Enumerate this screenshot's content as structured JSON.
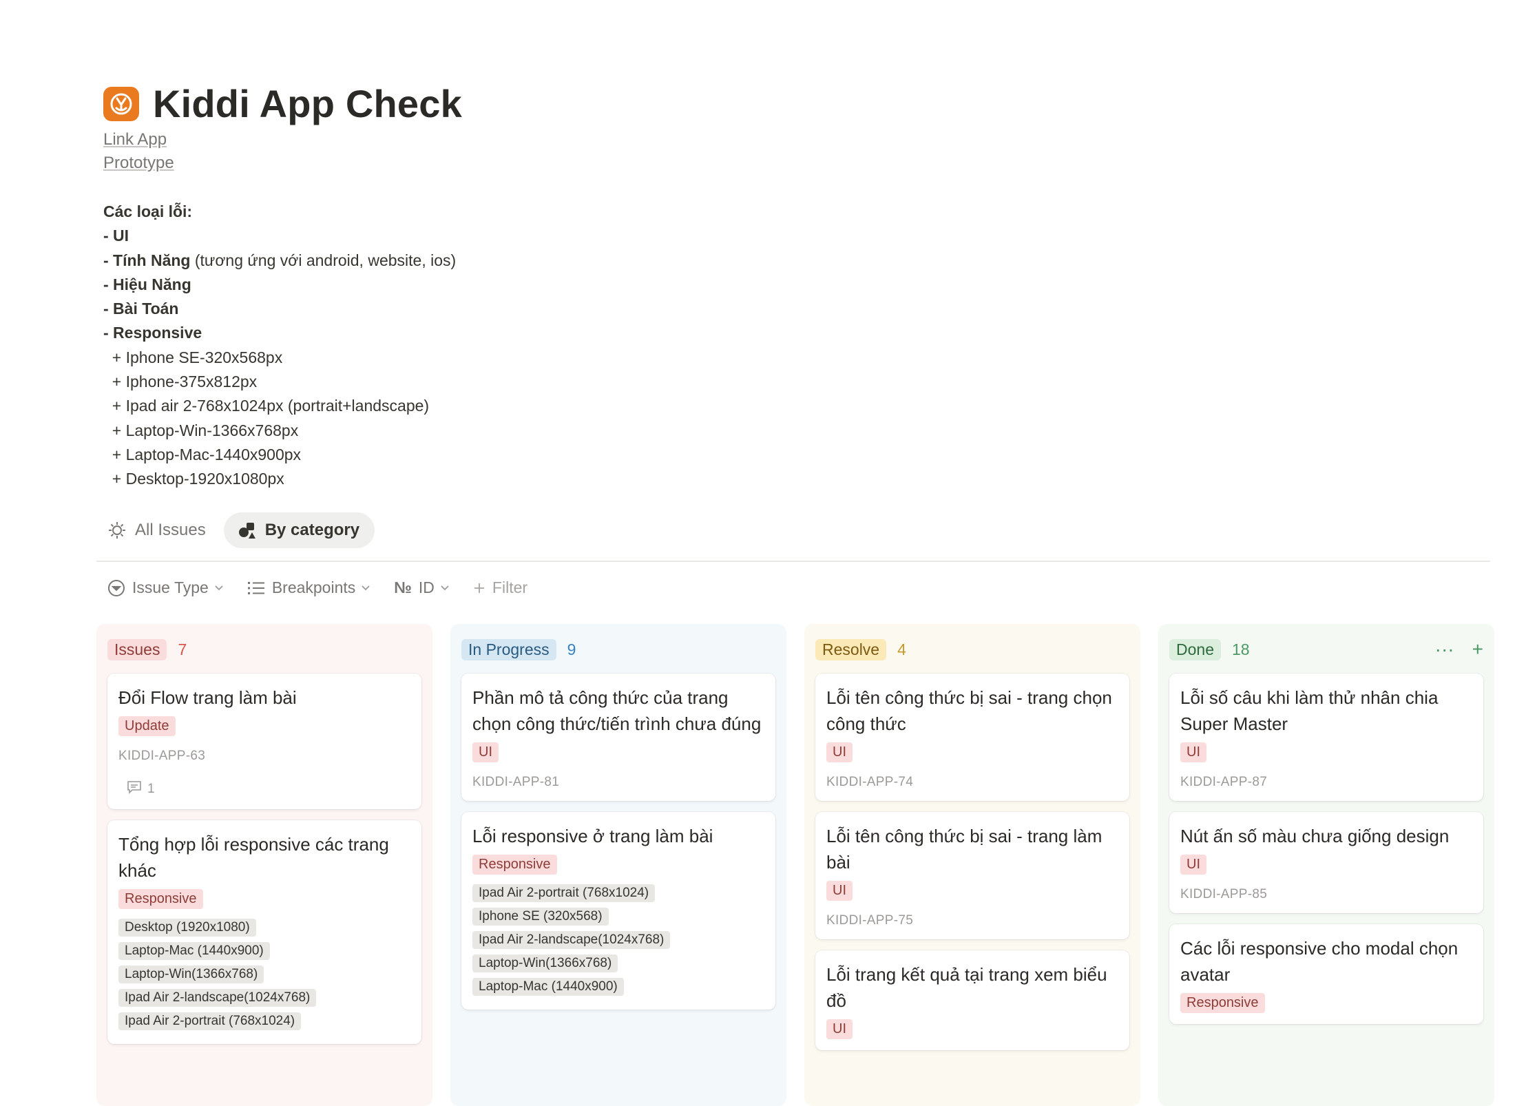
{
  "page": {
    "title": "Kiddi App Check",
    "links": [
      "Link App",
      "Prototype"
    ],
    "description": [
      {
        "bold": "Các loại lỗi:",
        "rest": ""
      },
      {
        "bold": "- UI",
        "rest": ""
      },
      {
        "bold": "- Tính Năng",
        "rest": " (tương ứng với android, website, ios)"
      },
      {
        "bold": "- Hiệu Năng",
        "rest": ""
      },
      {
        "bold": "- Bài Toán",
        "rest": ""
      },
      {
        "bold": "- Responsive",
        "rest": ""
      },
      {
        "bold": "",
        "rest": "  + Iphone SE-320x568px"
      },
      {
        "bold": "",
        "rest": "  + Iphone-375x812px"
      },
      {
        "bold": "",
        "rest": "  + Ipad air 2-768x1024px (portrait+landscape)"
      },
      {
        "bold": "",
        "rest": "  + Laptop-Win-1366x768px"
      },
      {
        "bold": "",
        "rest": "  + Laptop-Mac-1440x900px"
      },
      {
        "bold": "",
        "rest": "  + Desktop-1920x1080px"
      }
    ]
  },
  "views": {
    "all_issues": "All Issues",
    "by_category": "By category"
  },
  "filters": {
    "issue_type": "Issue Type",
    "breakpoints": "Breakpoints",
    "id": "ID",
    "id_prefix": "№",
    "filter": "Filter"
  },
  "columns": [
    {
      "key": "issues",
      "label": "Issues",
      "count": "7",
      "cards": [
        {
          "title": "Đổi Flow trang làm bài",
          "tag": "Update",
          "chips": [],
          "id": "KIDDI-APP-63",
          "comments": "1"
        },
        {
          "title": "Tổng hợp lỗi responsive các trang khác",
          "tag": "Responsive",
          "chips": [
            "Desktop (1920x1080)",
            "Laptop-Mac (1440x900)",
            "Laptop-Win(1366x768)",
            "Ipad Air 2-landscape(1024x768)",
            "Ipad Air 2-portrait (768x1024)"
          ],
          "id": "",
          "comments": ""
        }
      ]
    },
    {
      "key": "progress",
      "label": "In Progress",
      "count": "9",
      "cards": [
        {
          "title": "Phần mô tả công thức của trang chọn công thức/tiến trình chưa đúng",
          "tag": "UI",
          "chips": [],
          "id": "KIDDI-APP-81",
          "comments": ""
        },
        {
          "title": "Lỗi responsive ở trang làm bài",
          "tag": "Responsive",
          "chips": [
            "Ipad Air 2-portrait (768x1024)",
            "Iphone SE (320x568)",
            "Ipad Air 2-landscape(1024x768)",
            "Laptop-Win(1366x768)",
            "Laptop-Mac (1440x900)"
          ],
          "id": "",
          "comments": ""
        }
      ]
    },
    {
      "key": "resolve",
      "label": "Resolve",
      "count": "4",
      "cards": [
        {
          "title": "Lỗi tên công thức bị sai - trang chọn công thức",
          "tag": "UI",
          "chips": [],
          "id": "KIDDI-APP-74",
          "comments": ""
        },
        {
          "title": "Lỗi tên công thức bị sai - trang làm bài",
          "tag": "UI",
          "chips": [],
          "id": "KIDDI-APP-75",
          "comments": ""
        },
        {
          "title": "Lỗi trang kết quả tại trang xem biểu đồ",
          "tag": "UI",
          "chips": [],
          "id": "",
          "comments": ""
        }
      ]
    },
    {
      "key": "done",
      "label": "Done",
      "count": "18",
      "cards": [
        {
          "title": "Lỗi số câu khi làm thử nhân chia Super Master",
          "tag": "UI",
          "chips": [],
          "id": "KIDDI-APP-87",
          "comments": ""
        },
        {
          "title": "Nút ấn số màu chưa giống design",
          "tag": "UI",
          "chips": [],
          "id": "KIDDI-APP-85",
          "comments": ""
        },
        {
          "title": "Các lỗi responsive cho modal chọn avatar",
          "tag": "Responsive",
          "chips": [],
          "id": "",
          "comments": ""
        }
      ]
    }
  ],
  "done_actions": {
    "more": "···",
    "add": "+"
  },
  "colors": {
    "accent_orange": "#ea7a1f",
    "tag_red_bg": "#fbdcdc",
    "tag_red_text": "#8e3c37"
  }
}
